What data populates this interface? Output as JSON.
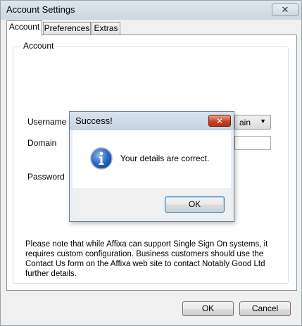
{
  "window": {
    "title": "Account Settings",
    "close_glyph": "✕"
  },
  "tabs": [
    "Account",
    "Preferences",
    "Extras"
  ],
  "group": {
    "title": "Account"
  },
  "form": {
    "username_label": "Username",
    "domain_label": "Domain",
    "password_label": "Password",
    "combo_value_visible": "ain",
    "combo_arrow": "▼"
  },
  "note": "Please note that while Affixa can support Single Sign On systems, it requires custom configuration. Business customers should use the Contact Us form on the Affixa web site to contact Notably Good Ltd further details.",
  "buttons": {
    "ok": "OK",
    "cancel": "Cancel"
  },
  "dialog": {
    "title": "Success!",
    "close_glyph": "✕",
    "message": "Your details are correct.",
    "ok": "OK",
    "icon": "info-icon"
  }
}
